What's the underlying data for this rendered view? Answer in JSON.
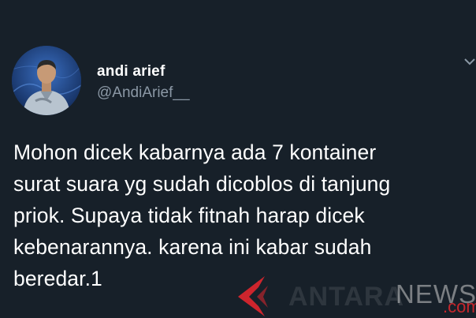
{
  "tweet": {
    "author": {
      "display_name": "andi arief",
      "handle": "@AndiArief__"
    },
    "text_lines": [
      "Mohon dicek kabarnya ada 7 kontainer",
      "surat suara yg sudah dicoblos di tanjung",
      "priok. Supaya tidak fitnah harap dicek",
      "kebenarannya. karena ini kabar sudah",
      "beredar.1"
    ],
    "more_icon": "chevron-down-icon"
  },
  "watermark": {
    "brand": "ANTARA",
    "news": "NEWS",
    "com": ".com",
    "logo_icon": "antara-logo-icon",
    "colors": {
      "red": "#e1262d",
      "gray": "#cdcdcd"
    }
  },
  "colors": {
    "background": "#172029",
    "text_primary": "#ffffff",
    "text_secondary": "#8b98a5"
  }
}
